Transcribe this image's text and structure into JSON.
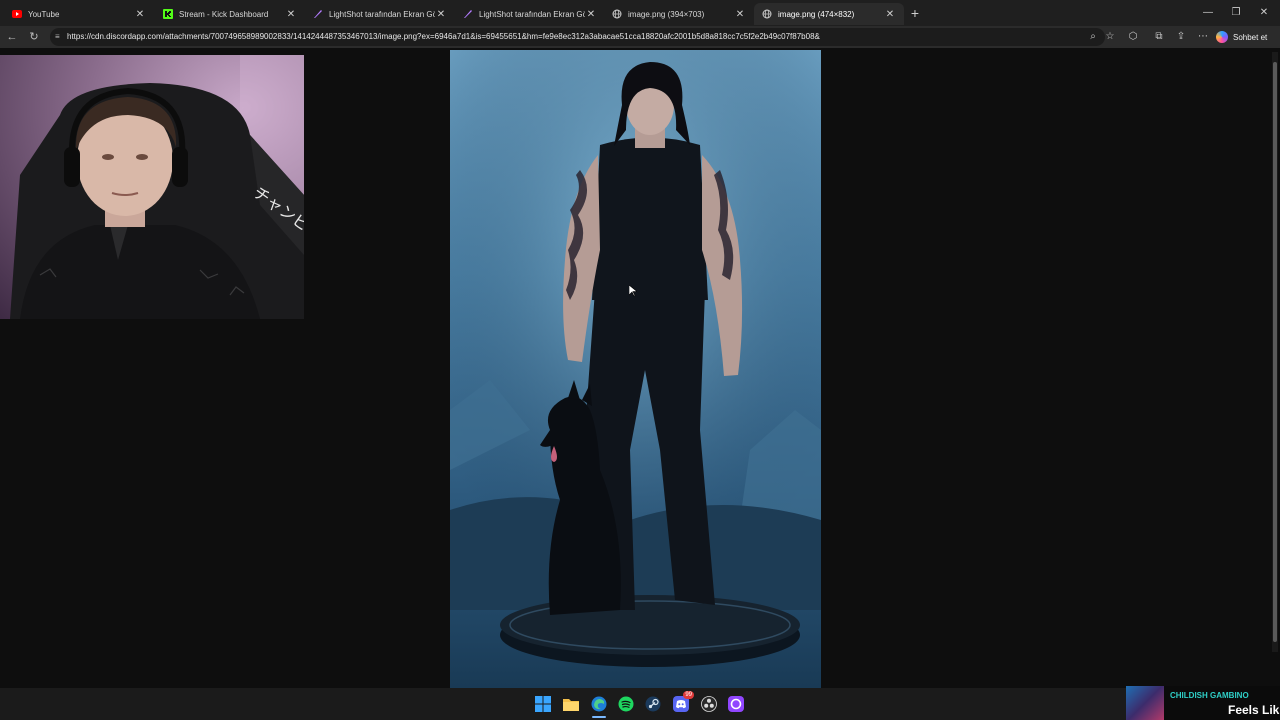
{
  "browser": {
    "tabs": [
      {
        "title": "YouTube",
        "icon": "youtube-icon",
        "active": false
      },
      {
        "title": "Stream - Kick Dashboard",
        "icon": "kick-icon",
        "active": false
      },
      {
        "title": "LightShot tarafından Ekran Görüntüsü",
        "icon": "lightshot-icon",
        "active": false
      },
      {
        "title": "LightShot tarafından Ekran Görüntüsü",
        "icon": "lightshot-icon",
        "active": false
      },
      {
        "title": "image.png (394×703)",
        "icon": "globe-icon",
        "active": false
      },
      {
        "title": "image.png (474×832)",
        "icon": "globe-icon",
        "active": true
      }
    ],
    "new_tab_label": "+",
    "window_controls": {
      "minimize": "—",
      "maximize": "❐",
      "close": "✕"
    },
    "url": "https://cdn.discordapp.com/attachments/700749658989002833/1414244487353467013/image.png?ex=6946a7d1&is=69455651&hm=fe9e8ec312a3abacae51cca18820afc2001b5d8a818cc7c5f2e2b49c07f87b08&",
    "chat_button_label": "Sohbet et"
  },
  "taskbar": {
    "icons": [
      "windows-start-icon",
      "file-explorer-icon",
      "edge-icon",
      "spotify-icon",
      "steam-icon",
      "discord-icon",
      "obs-icon",
      "twitch-icon"
    ],
    "discord_badge": "99"
  },
  "now_playing": {
    "artist": "CHILDISH GAMBINO",
    "track": "Feels Lik"
  },
  "colors": {
    "tabbar_bg": "#1f1f1f",
    "address_bg": "#2b2b2b",
    "page_bg": "#0e0e0e",
    "taskbar_bg": "#1b1b1b",
    "accent_teal": "#2fd0c8"
  }
}
